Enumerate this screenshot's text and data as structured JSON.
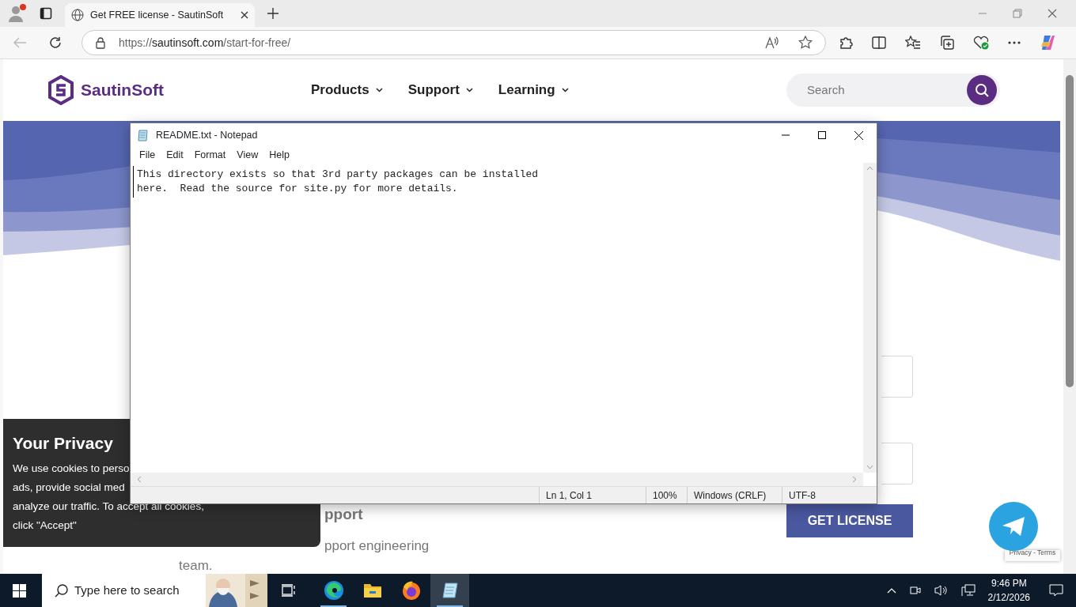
{
  "browser": {
    "tab_title": "Get FREE license - SautinSoft",
    "url_scheme": "https://",
    "url_host": "sautinsoft.com",
    "url_path": "/start-for-free/"
  },
  "site": {
    "logo": "SautinSoft",
    "nav": [
      {
        "label": "Products"
      },
      {
        "label": "Support"
      },
      {
        "label": "Learning"
      }
    ],
    "search": {
      "placeholder": "Search"
    },
    "fragments": [
      "pport",
      "pport engineering",
      "team."
    ],
    "get_license": "GET LICENSE",
    "recaptcha": "Privacy - Terms"
  },
  "privacy": {
    "title": "Your Privacy",
    "lines": [
      "We use cookies to perso",
      "ads, provide social med",
      "analyze our traffic. To accept all cookies,",
      "click \"Accept\""
    ]
  },
  "notepad": {
    "title": "README.txt - Notepad",
    "menu": [
      "File",
      "Edit",
      "Format",
      "View",
      "Help"
    ],
    "lines": [
      "This directory exists so that 3rd party packages can be installed",
      "here.  Read the source for site.py for more details."
    ],
    "status": [
      "Ln 1, Col 1",
      "100%",
      "Windows (CRLF)",
      "UTF-8"
    ]
  },
  "taskbar": {
    "search_placeholder": "Type here to search",
    "apps": [
      {
        "kind": "edge",
        "running": true,
        "selected": false
      },
      {
        "kind": "folder",
        "running": false,
        "selected": false
      },
      {
        "kind": "firefox",
        "running": false,
        "selected": false
      },
      {
        "kind": "notepad",
        "running": true,
        "selected": true
      }
    ],
    "time": "9:46 PM",
    "date": "2/12/2026"
  }
}
